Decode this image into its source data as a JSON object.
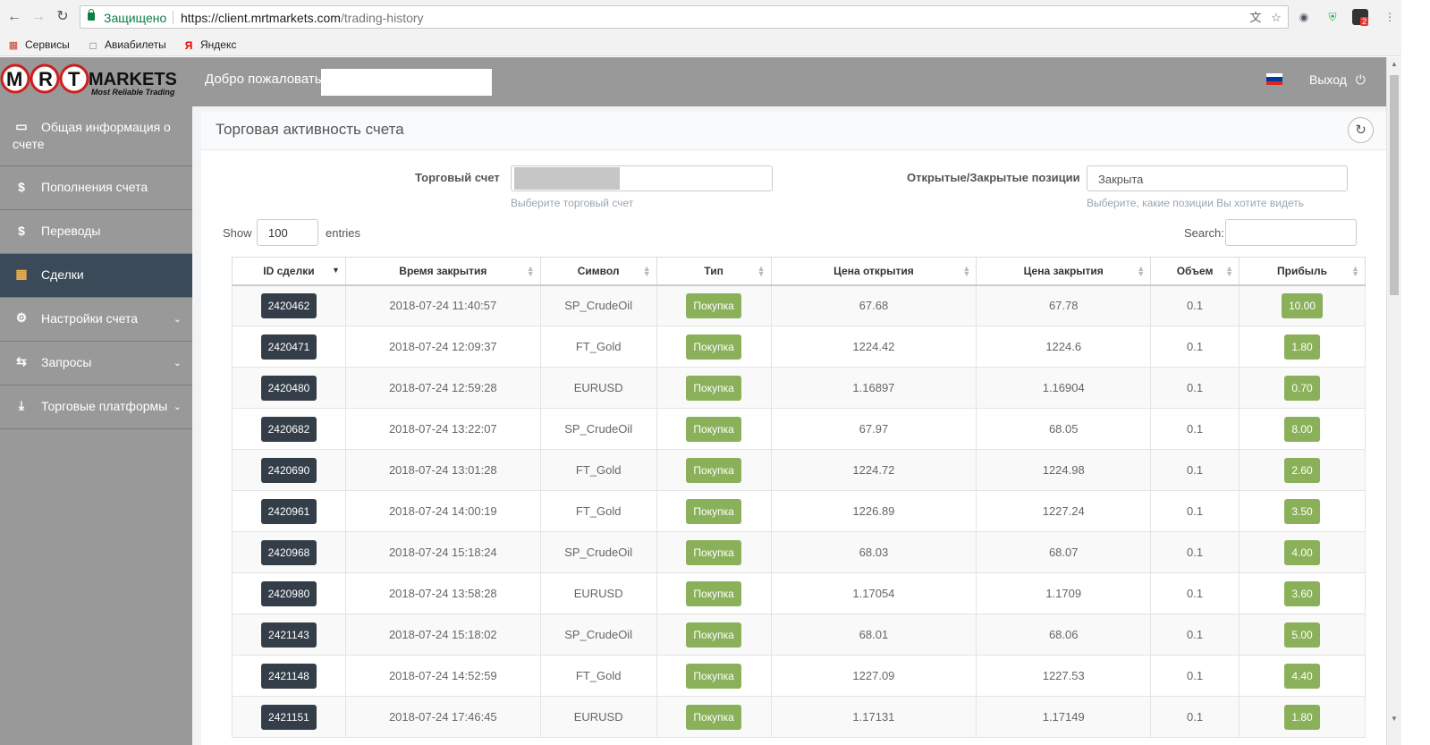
{
  "browser": {
    "secure_label": "Защищено",
    "url_host": "https://client.mrtmarkets.com",
    "url_path": "/trading-history",
    "ext_badge": "2",
    "bookmarks": [
      {
        "label": "Сервисы",
        "icon": "apps-grid-icon"
      },
      {
        "label": "Авиабилеты",
        "icon": "page-icon"
      },
      {
        "label": "Яндекс",
        "icon": "yandex-icon"
      }
    ]
  },
  "header": {
    "logo_text": "MRT MARKETS",
    "logo_tagline": "Most Reliable Trading",
    "welcome": "Добро пожаловать",
    "logout": "Выход",
    "flag_colors": [
      "#ffffff",
      "#0039a6",
      "#d52b1e"
    ]
  },
  "sidebar": {
    "items": [
      {
        "label": "Общая информация о счете",
        "icon": "monitor-icon",
        "active": false,
        "expandable": false
      },
      {
        "label": "Пополнения счета",
        "icon": "dollar-icon",
        "active": false,
        "expandable": false
      },
      {
        "label": "Переводы",
        "icon": "dollar-icon",
        "active": false,
        "expandable": false
      },
      {
        "label": "Сделки",
        "icon": "bar-chart-icon",
        "active": true,
        "expandable": false
      },
      {
        "label": "Настройки счета",
        "icon": "cogs-icon",
        "active": false,
        "expandable": true
      },
      {
        "label": "Запросы",
        "icon": "exchange-icon",
        "active": false,
        "expandable": true
      },
      {
        "label": "Торговые платформы",
        "icon": "download-icon",
        "active": false,
        "expandable": true
      }
    ]
  },
  "panel": {
    "title": "Торговая активность счета",
    "account_label": "Торговый счет",
    "account_help": "Выберите торговый счет",
    "positions_label": "Открытые/Закрытые позиции",
    "positions_value": "Закрыта",
    "positions_help": "Выберите, какие позиции Вы хотите видеть",
    "show_label": "Show",
    "entries_value": "100",
    "entries_label": "entries",
    "search_label": "Search:"
  },
  "table": {
    "columns": [
      "ID сделки",
      "Время закрытия",
      "Символ",
      "Тип",
      "Цена открытия",
      "Цена закрытия",
      "Объем",
      "Прибыль"
    ],
    "rows": [
      [
        "2420462",
        "2018-07-24 11:40:57",
        "SP_CrudeOil",
        "Покупка",
        "67.68",
        "67.78",
        "0.1",
        "10.00"
      ],
      [
        "2420471",
        "2018-07-24 12:09:37",
        "FT_Gold",
        "Покупка",
        "1224.42",
        "1224.6",
        "0.1",
        "1.80"
      ],
      [
        "2420480",
        "2018-07-24 12:59:28",
        "EURUSD",
        "Покупка",
        "1.16897",
        "1.16904",
        "0.1",
        "0.70"
      ],
      [
        "2420682",
        "2018-07-24 13:22:07",
        "SP_CrudeOil",
        "Покупка",
        "67.97",
        "68.05",
        "0.1",
        "8.00"
      ],
      [
        "2420690",
        "2018-07-24 13:01:28",
        "FT_Gold",
        "Покупка",
        "1224.72",
        "1224.98",
        "0.1",
        "2.60"
      ],
      [
        "2420961",
        "2018-07-24 14:00:19",
        "FT_Gold",
        "Покупка",
        "1226.89",
        "1227.24",
        "0.1",
        "3.50"
      ],
      [
        "2420968",
        "2018-07-24 15:18:24",
        "SP_CrudeOil",
        "Покупка",
        "68.03",
        "68.07",
        "0.1",
        "4.00"
      ],
      [
        "2420980",
        "2018-07-24 13:58:28",
        "EURUSD",
        "Покупка",
        "1.17054",
        "1.1709",
        "0.1",
        "3.60"
      ],
      [
        "2421143",
        "2018-07-24 15:18:02",
        "SP_CrudeOil",
        "Покупка",
        "68.01",
        "68.06",
        "0.1",
        "5.00"
      ],
      [
        "2421148",
        "2018-07-24 14:52:59",
        "FT_Gold",
        "Покупка",
        "1227.09",
        "1227.53",
        "0.1",
        "4.40"
      ],
      [
        "2421151",
        "2018-07-24 17:46:45",
        "EURUSD",
        "Покупка",
        "1.17131",
        "1.17149",
        "0.1",
        "1.80"
      ]
    ]
  },
  "colors": {
    "sidebar_bg": "#999999",
    "sidebar_active": "#3a4a58",
    "badge_dark": "#333e48",
    "badge_green": "#8ab15a"
  }
}
